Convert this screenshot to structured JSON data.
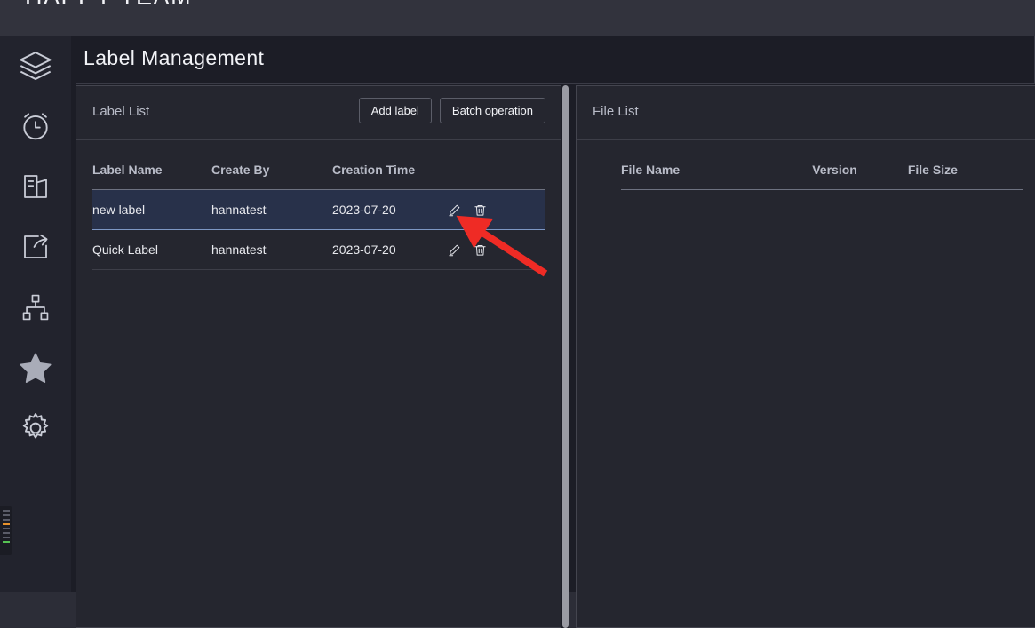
{
  "app": {
    "brand": "HAPPY TEAM"
  },
  "page": {
    "title": "Label Management"
  },
  "sidebar": {
    "items": [
      {
        "icon": "layers-icon",
        "name": "sidebar-item-layers"
      },
      {
        "icon": "alarm-clock-icon",
        "name": "sidebar-item-alarm"
      },
      {
        "icon": "bar-chart-building-icon",
        "name": "sidebar-item-statistics"
      },
      {
        "icon": "share-export-icon",
        "name": "sidebar-item-share"
      },
      {
        "icon": "sitemap-icon",
        "name": "sidebar-item-structure"
      },
      {
        "icon": "star-icon",
        "name": "sidebar-item-favorites"
      },
      {
        "icon": "gear-icon",
        "name": "sidebar-item-settings"
      }
    ]
  },
  "label_panel": {
    "title": "Label List",
    "add_label_button": "Add label",
    "batch_operation_button": "Batch operation",
    "columns": [
      "Label Name",
      "Create By",
      "Creation Time",
      ""
    ],
    "rows": [
      {
        "label_name": "new label",
        "create_by": "hannatest",
        "creation_time": "2023-07-20",
        "selected": true,
        "edit_icon": "pencil-icon",
        "delete_icon": "trash-icon"
      },
      {
        "label_name": "Quick Label",
        "create_by": "hannatest",
        "creation_time": "2023-07-20",
        "selected": false,
        "edit_icon": "pencil-icon",
        "delete_icon": "trash-icon"
      }
    ]
  },
  "file_panel": {
    "title": "File List",
    "columns": [
      "File Name",
      "Version",
      "File Size"
    ],
    "rows": []
  },
  "annotation": {
    "arrow_color": "#ef2b25",
    "points_at": "edit-icon-of-new-label-row"
  },
  "colors": {
    "topbar": "#32333d",
    "sidebar": "#22232d",
    "content": "#1c1d26",
    "panel": "#25262f",
    "selected_row": "#28314a",
    "accent_border": "#7d97c4"
  }
}
